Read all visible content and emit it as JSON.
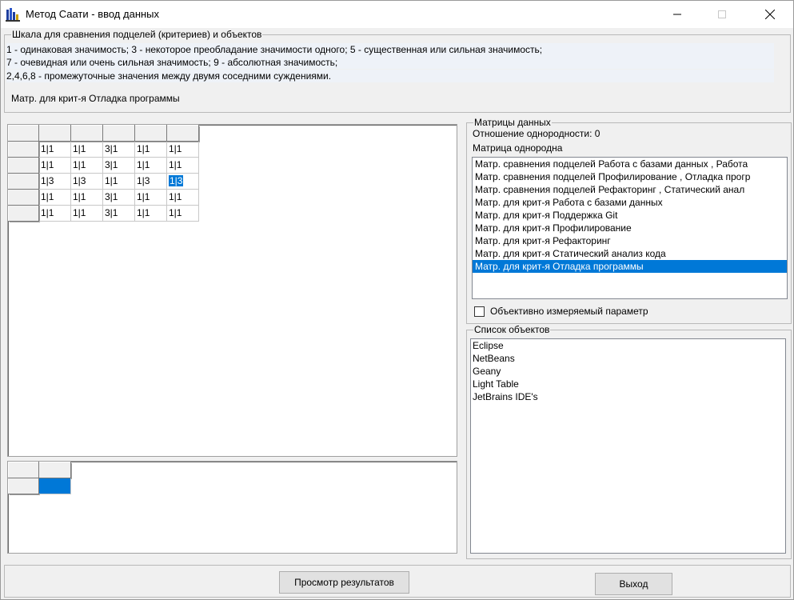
{
  "window": {
    "title": "Метод Саати - ввод данных"
  },
  "scale": {
    "legend": "Шкала для сравнения подцелей (критериев) и объектов",
    "lines": [
      "1 - одинаковая значимость; 3 - некоторое преобладание значимости одного; 5 - существенная или сильная значимость;",
      "7 - очевидная или очень сильная значимость; 9 - абсолютная значимость;",
      "2,4,6,8 - промежуточные значения между двумя соседними суждениями."
    ],
    "current_matrix": "Матр. для крит-я Отладка программы"
  },
  "matrix": {
    "rows": [
      [
        "1|1",
        "1|1",
        "3|1",
        "1|1",
        "1|1"
      ],
      [
        "1|1",
        "1|1",
        "3|1",
        "1|1",
        "1|1"
      ],
      [
        "1|3",
        "1|3",
        "1|1",
        "1|3",
        "1|3"
      ],
      [
        "1|1",
        "1|1",
        "3|1",
        "1|1",
        "1|1"
      ],
      [
        "1|1",
        "1|1",
        "3|1",
        "1|1",
        "1|1"
      ]
    ]
  },
  "data_matrices": {
    "legend": "Матрицы данных",
    "homogeneity_ratio": "Отношение однородности: 0",
    "homogeneity_status": "Матрица однородна",
    "items": [
      "Матр. сравнения подцелей Работа с базами данных , Работа",
      "Матр. сравнения подцелей Профилирование , Отладка прогр",
      "Матр. сравнения подцелей Рефакторинг , Статический анал",
      "Матр. для крит-я Работа с базами данных",
      "Матр. для крит-я Поддержка Git",
      "Матр. для крит-я Профилирование",
      "Матр. для крит-я Рефакторинг",
      "Матр. для крит-я Статический анализ кода",
      "Матр. для крит-я Отладка программы"
    ],
    "selected_index": 8,
    "objective_checkbox_label": "Объективно измеряемый параметр"
  },
  "objects": {
    "legend": "Список объектов",
    "items": [
      "Eclipse",
      "NetBeans",
      "Geany",
      "Light Table",
      "JetBrains IDE's"
    ]
  },
  "buttons": {
    "view_results": "Просмотр результатов",
    "exit": "Выход"
  },
  "colors": {
    "selection": "#0078d7",
    "face": "#f0f0f0"
  }
}
